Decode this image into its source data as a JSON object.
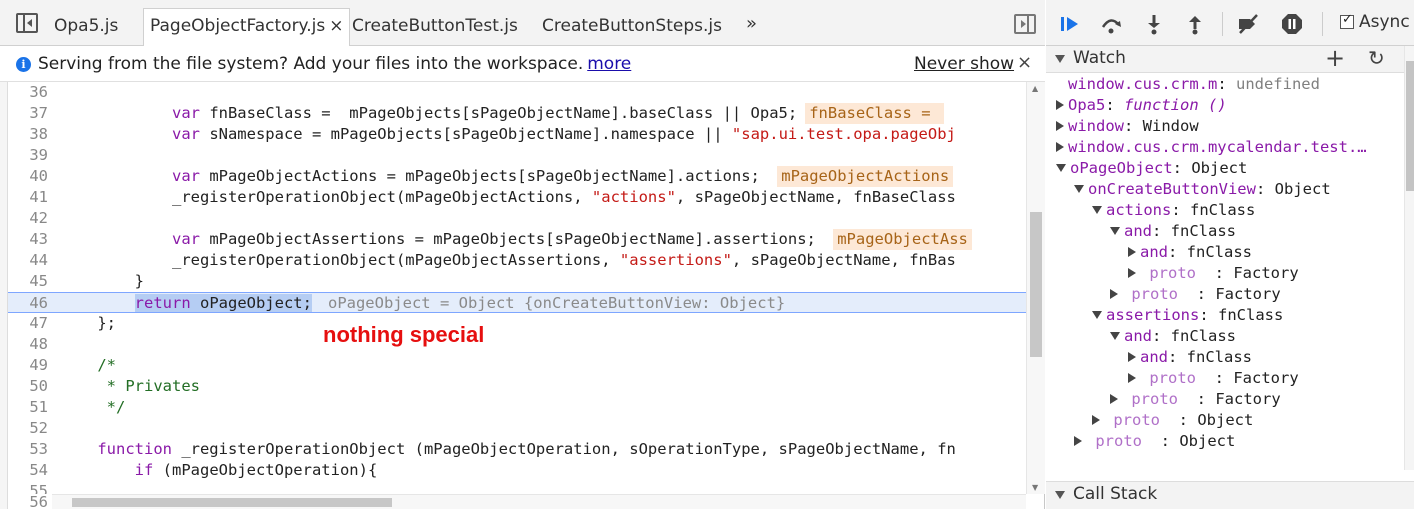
{
  "tabs": [
    {
      "label": "Opa5.js"
    },
    {
      "label": "PageObjectFactory.js",
      "close": "×"
    },
    {
      "label": "CreateButtonTest.js"
    },
    {
      "label": "CreateButtonSteps.js"
    }
  ],
  "tab_overflow": "»",
  "infobar": {
    "icon": "i",
    "message": "Serving from the file system? Add your files into the workspace.",
    "link": "more",
    "never_show": "Never show",
    "close": "×"
  },
  "code_lines": [
    {
      "n": "36",
      "segs": []
    },
    {
      "n": "37",
      "segs": [
        {
          "t": "            "
        },
        {
          "t": "var",
          "c": "kw"
        },
        {
          "t": " fnBaseClass =  mPageObjects[sPageObjectName].baseClass || Opa5;"
        },
        {
          "t": "fnBaseClass = ",
          "c": "inline-val"
        }
      ]
    },
    {
      "n": "38",
      "segs": [
        {
          "t": "            "
        },
        {
          "t": "var",
          "c": "kw"
        },
        {
          "t": " sNamespace = mPageObjects[sPageObjectName].namespace || "
        },
        {
          "t": "\"sap.ui.test.opa.pageObj",
          "c": "str"
        }
      ]
    },
    {
      "n": "39",
      "segs": []
    },
    {
      "n": "40",
      "segs": [
        {
          "t": "            "
        },
        {
          "t": "var",
          "c": "kw"
        },
        {
          "t": " mPageObjectActions = mPageObjects[sPageObjectName].actions; "
        },
        {
          "t": "mPageObjectActions",
          "c": "inline-val"
        }
      ]
    },
    {
      "n": "41",
      "segs": [
        {
          "t": "            _registerOperationObject(mPageObjectActions, "
        },
        {
          "t": "\"actions\"",
          "c": "str"
        },
        {
          "t": ", sPageObjectName, fnBaseClass"
        }
      ]
    },
    {
      "n": "42",
      "segs": []
    },
    {
      "n": "43",
      "segs": [
        {
          "t": "            "
        },
        {
          "t": "var",
          "c": "kw"
        },
        {
          "t": " mPageObjectAssertions = mPageObjects[sPageObjectName].assertions; "
        },
        {
          "t": "mPageObjectAss",
          "c": "inline-val"
        }
      ]
    },
    {
      "n": "44",
      "segs": [
        {
          "t": "            _registerOperationObject(mPageObjectAssertions, "
        },
        {
          "t": "\"assertions\"",
          "c": "str"
        },
        {
          "t": ", sPageObjectName, fnBas"
        }
      ]
    },
    {
      "n": "45",
      "segs": [
        {
          "t": "        }"
        }
      ]
    },
    {
      "n": "46",
      "current": true,
      "segs": [
        {
          "t": "        "
        },
        {
          "t": "return",
          "c": "kw sel"
        },
        {
          "t": " oPageObject;",
          "c": "sel"
        },
        {
          "t": "oPageObject = Object {onCreateButtonView: Object}",
          "c": "inline-gray"
        }
      ]
    },
    {
      "n": "47",
      "segs": [
        {
          "t": "    };"
        }
      ]
    },
    {
      "n": "48",
      "segs": []
    },
    {
      "n": "49",
      "segs": [
        {
          "t": "    "
        },
        {
          "t": "/*",
          "c": "cm"
        }
      ]
    },
    {
      "n": "50",
      "segs": [
        {
          "t": "     * Privates",
          "c": "cm"
        }
      ]
    },
    {
      "n": "51",
      "segs": [
        {
          "t": "     */",
          "c": "cm"
        }
      ]
    },
    {
      "n": "52",
      "segs": []
    },
    {
      "n": "53",
      "segs": [
        {
          "t": "    "
        },
        {
          "t": "function",
          "c": "kw"
        },
        {
          "t": " _registerOperationObject (mPageObjectOperation, sOperationType, sPageObjectName, fn"
        }
      ]
    },
    {
      "n": "54",
      "segs": [
        {
          "t": "        "
        },
        {
          "t": "if",
          "c": "kw"
        },
        {
          "t": " (mPageObjectOperation){"
        }
      ]
    },
    {
      "n": "55",
      "segs": []
    }
  ],
  "last_partial_line": "56",
  "annotation": "nothing special",
  "debugger": {
    "async_label": "Async",
    "watch_title": "Watch",
    "watch_add": "+",
    "watch_refresh": "↻",
    "callstack_title": "Call Stack"
  },
  "watch_rows": [
    {
      "indent": 0,
      "tri": "none",
      "key": "window.cus.crm.m",
      "sep": ": ",
      "val": "undefined",
      "vc": "wu"
    },
    {
      "indent": 0,
      "tri": "right",
      "key": "Opa5",
      "sep": ": ",
      "val": "function ()",
      "vc": "wf"
    },
    {
      "indent": 0,
      "tri": "right",
      "key": "window",
      "sep": ": ",
      "val": "Window",
      "vc": "wv"
    },
    {
      "indent": 0,
      "tri": "right",
      "key": "window.cus.crm.mycalendar.test.…",
      "sep": "",
      "val": "",
      "vc": "wv"
    },
    {
      "indent": 0,
      "tri": "down",
      "key": "oPageObject",
      "sep": ": ",
      "val": "Object",
      "vc": "wv"
    },
    {
      "indent": 1,
      "tri": "down",
      "key": "onCreateButtonView",
      "sep": ": ",
      "val": "Object",
      "vc": "wv"
    },
    {
      "indent": 2,
      "tri": "down",
      "key": "actions",
      "sep": ": ",
      "val": "fnClass",
      "vc": "wv"
    },
    {
      "indent": 3,
      "tri": "down",
      "key": "and",
      "sep": ": ",
      "val": "fnClass",
      "vc": "wv"
    },
    {
      "indent": 4,
      "tri": "right",
      "key": "and",
      "sep": ": ",
      "val": "fnClass",
      "vc": "wv"
    },
    {
      "indent": 4,
      "tri": "right",
      "key": " proto ",
      "sep": " : ",
      "val": "Factory",
      "vc": "wv",
      "proto": true
    },
    {
      "indent": 3,
      "tri": "right",
      "key": " proto ",
      "sep": " : ",
      "val": "Factory",
      "vc": "wv",
      "proto": true
    },
    {
      "indent": 2,
      "tri": "down",
      "key": "assertions",
      "sep": ": ",
      "val": "fnClass",
      "vc": "wv"
    },
    {
      "indent": 3,
      "tri": "down",
      "key": "and",
      "sep": ": ",
      "val": "fnClass",
      "vc": "wv"
    },
    {
      "indent": 4,
      "tri": "right",
      "key": "and",
      "sep": ": ",
      "val": "fnClass",
      "vc": "wv"
    },
    {
      "indent": 4,
      "tri": "right",
      "key": " proto ",
      "sep": " : ",
      "val": "Factory",
      "vc": "wv",
      "proto": true
    },
    {
      "indent": 3,
      "tri": "right",
      "key": " proto ",
      "sep": " : ",
      "val": "Factory",
      "vc": "wv",
      "proto": true
    },
    {
      "indent": 2,
      "tri": "right",
      "key": " proto ",
      "sep": " : ",
      "val": "Object",
      "vc": "wv",
      "proto": true
    },
    {
      "indent": 1,
      "tri": "right",
      "key": " proto ",
      "sep": " : ",
      "val": "Object",
      "vc": "wv",
      "proto": true
    }
  ],
  "colors": {
    "accent_blue": "#1a73e8",
    "keyword_purple": "#8a1aa8",
    "string_red": "#c41a16",
    "comment_green": "#236e25",
    "annotation_red": "#e60f0f",
    "current_line_bg": "#e4edfb"
  }
}
